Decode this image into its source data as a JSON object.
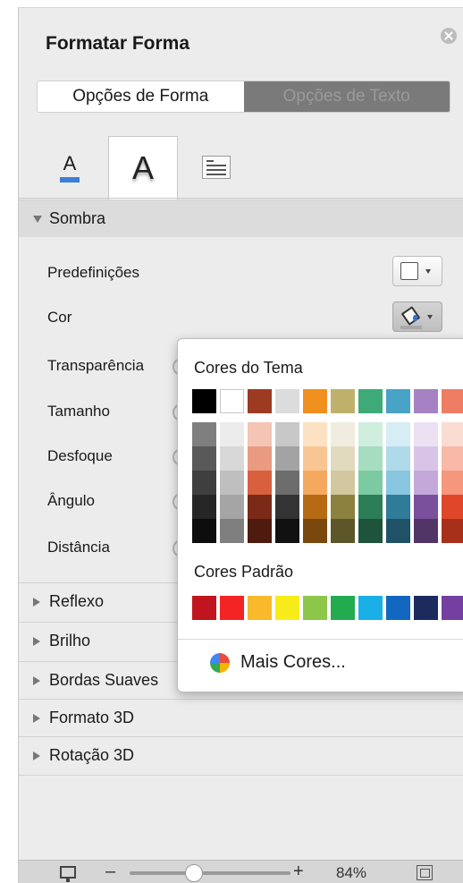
{
  "panel": {
    "title": "Formatar Forma",
    "segment": {
      "shape_options": "Opções de Forma",
      "text_options": "Opções de Texto"
    }
  },
  "sections": {
    "shadow": {
      "header": "Sombra",
      "rows": {
        "presets": "Predefinições",
        "color": "Cor",
        "transparency": "Transparência",
        "size": "Tamanho",
        "blur": "Desfoque",
        "angle": "Ângulo",
        "distance": "Distância"
      }
    },
    "collapsed": [
      "Reflexo",
      "Brilho",
      "Bordas Suaves",
      "Formato 3D",
      "Rotação 3D"
    ]
  },
  "color_picker": {
    "theme_title": "Cores do Tema",
    "standard_title": "Cores Padrão",
    "more_colors": "Mais Cores...",
    "theme_top": [
      "#000000",
      "#ffffff",
      "#9c3a22",
      "#dcdcdc",
      "#f0901e",
      "#bfb16c",
      "#3daa78",
      "#48a3c6",
      "#a682c3",
      "#ef7d63"
    ],
    "theme_shades": [
      [
        "#7f7f7f",
        "#595959",
        "#3f3f3f",
        "#262626",
        "#0d0d0d"
      ],
      [
        "#ececec",
        "#d8d8d8",
        "#bfbfbf",
        "#a5a5a5",
        "#7f7f7f"
      ],
      [
        "#f4c4b4",
        "#ea9a80",
        "#d9603f",
        "#7a2a17",
        "#4e1b0e"
      ],
      [
        "#c8c8c8",
        "#a3a3a3",
        "#6d6d6d",
        "#333333",
        "#111111"
      ],
      [
        "#fce1c2",
        "#f9c592",
        "#f5a95f",
        "#b66a14",
        "#7a470d"
      ],
      [
        "#f0ece0",
        "#e2dabf",
        "#d2c79f",
        "#8d8140",
        "#5e562b"
      ],
      [
        "#cfeedd",
        "#a6dcc0",
        "#7ccaa2",
        "#2c7e58",
        "#1d543b"
      ],
      [
        "#d6edf5",
        "#afdaea",
        "#88c7df",
        "#2f7b98",
        "#1f5266"
      ],
      [
        "#ebe1f2",
        "#d8c4e6",
        "#c5a8da",
        "#7a4f9b",
        "#523567"
      ],
      [
        "#fbdcd3",
        "#f8b9a8",
        "#f5977c",
        "#e0472a",
        "#a7301a"
      ]
    ],
    "standard": [
      "#c0151e",
      "#f42424",
      "#f8b92b",
      "#f7ec19",
      "#8dc74a",
      "#23ab4f",
      "#1aafe6",
      "#1167c0",
      "#1c2b5e",
      "#7340a2"
    ]
  },
  "statusbar": {
    "zoom_out": "–",
    "zoom_in": "+",
    "zoom_percent": "84%"
  }
}
